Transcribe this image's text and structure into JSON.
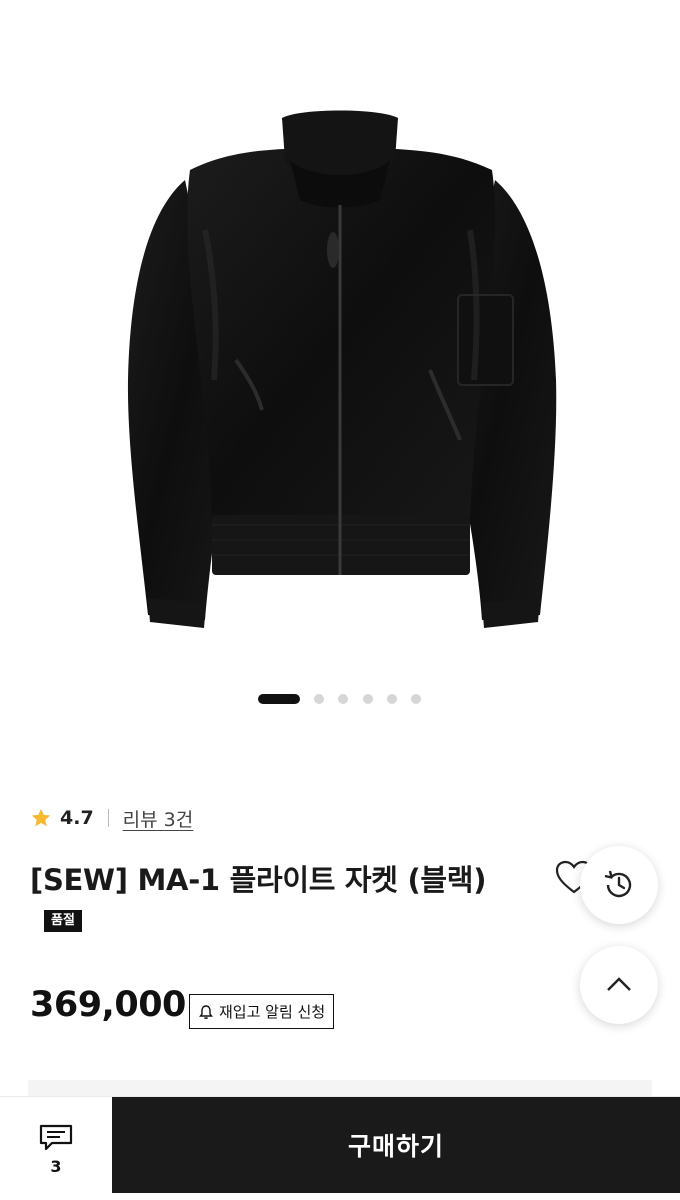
{
  "product": {
    "rating": "4.7",
    "review_link": "리뷰 3건",
    "title": "[SEW] MA-1 플라이트 자켓 (블랙)",
    "sold_out_badge": "품절",
    "price": "369,000",
    "restock_label": "재입고 알림 신청"
  },
  "gallery": {
    "image_count": 6,
    "active_index": 0
  },
  "bottom_bar": {
    "chat_count": "3",
    "buy_label": "구매하기"
  },
  "colors": {
    "star": "#F5B82E",
    "primary_dark": "#1a1a1a",
    "dot_inactive": "#d6d6d6"
  },
  "icons": {
    "rating": "star-icon",
    "wishlist": "heart-icon",
    "history": "history-icon",
    "scroll_top": "chevron-up-icon",
    "restock": "bell-icon",
    "chat": "chat-icon"
  }
}
